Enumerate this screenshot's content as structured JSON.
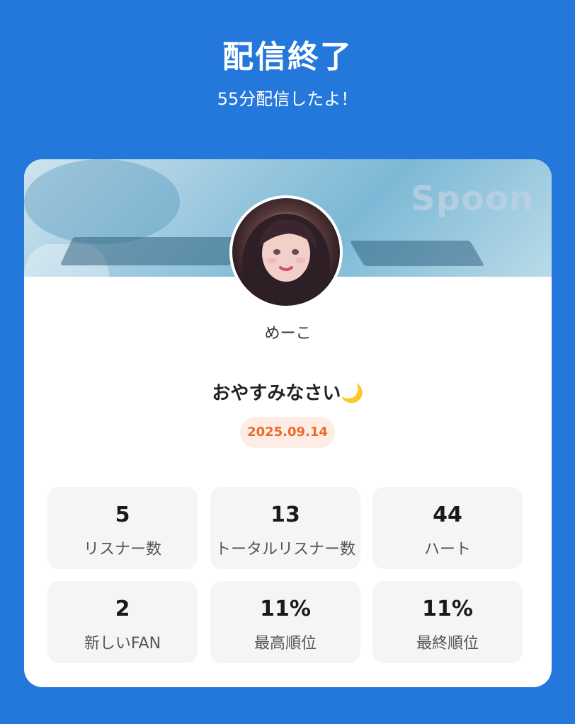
{
  "header": {
    "title": "配信終了",
    "subtitle": "55分配信したよ！"
  },
  "banner": {
    "watermark": "Spoon"
  },
  "profile": {
    "username": "めーこ",
    "status_message": "おやすみなさい🌙",
    "date": "2025.09.14"
  },
  "stats": [
    {
      "value": "5",
      "label": "リスナー数"
    },
    {
      "value": "13",
      "label": "トータルリスナー数"
    },
    {
      "value": "44",
      "label": "ハート"
    },
    {
      "value": "2",
      "label": "新しいFAN"
    },
    {
      "value": "11%",
      "label": "最高順位"
    },
    {
      "value": "11%",
      "label": "最終順位"
    }
  ],
  "colors": {
    "background": "#2478DC",
    "card": "#FFFFFF",
    "date_badge_bg": "#FDEDE4",
    "date_badge_text": "#EC6A2A",
    "stat_bg": "#F5F5F5"
  }
}
